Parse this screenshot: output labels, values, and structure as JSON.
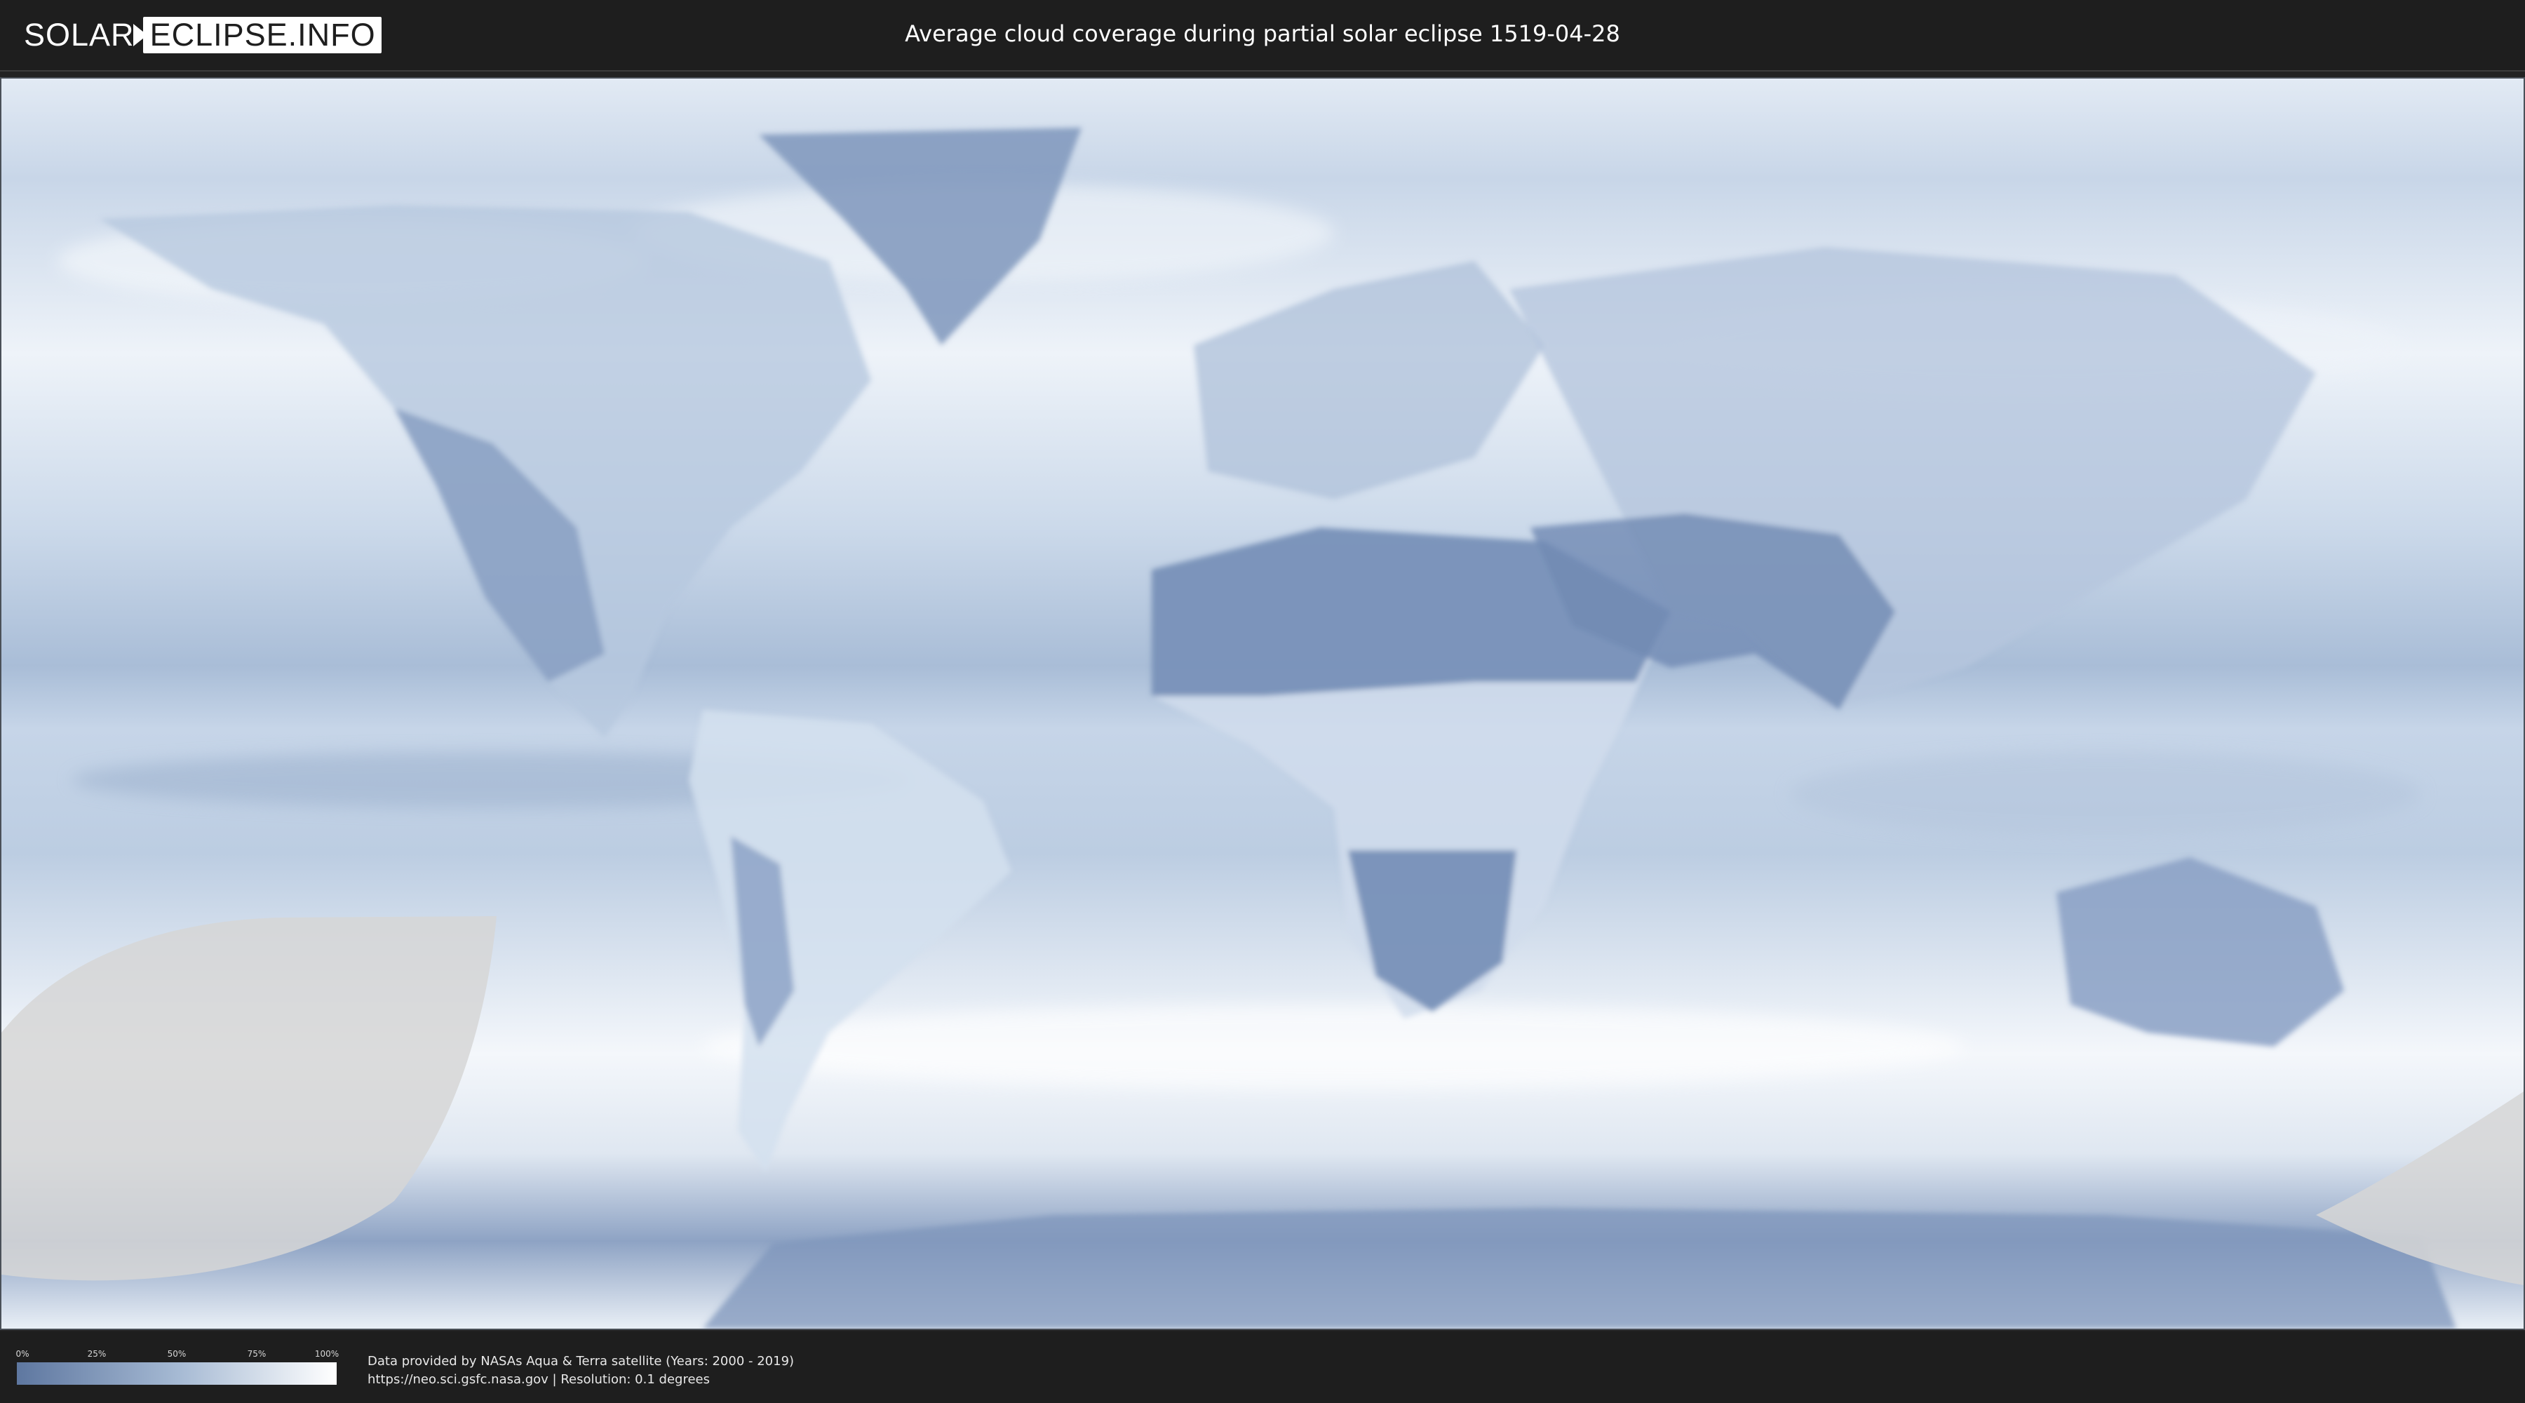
{
  "header": {
    "logo_left": "SOLAR",
    "logo_right": "ECLIPSE.INFO",
    "title": "Average cloud coverage during partial solar eclipse 1519-04-28"
  },
  "legend": {
    "ticks": [
      "0%",
      "25%",
      "50%",
      "75%",
      "100%"
    ],
    "color_low": "#5e77a0",
    "color_high": "#ffffff"
  },
  "credits": {
    "line1": "Data provided by NASAs Aqua & Terra satellite (Years: 2000 - 2019)",
    "line2": "https://neo.sci.gsfc.nasa.gov | Resolution: 0.1 degrees"
  },
  "colors": {
    "header_bg": "#1e1e1e",
    "ocean_cloud": "#c9d7e8",
    "clear_land": "#7890b8",
    "eclipse_zone": "#d6d6d6"
  }
}
